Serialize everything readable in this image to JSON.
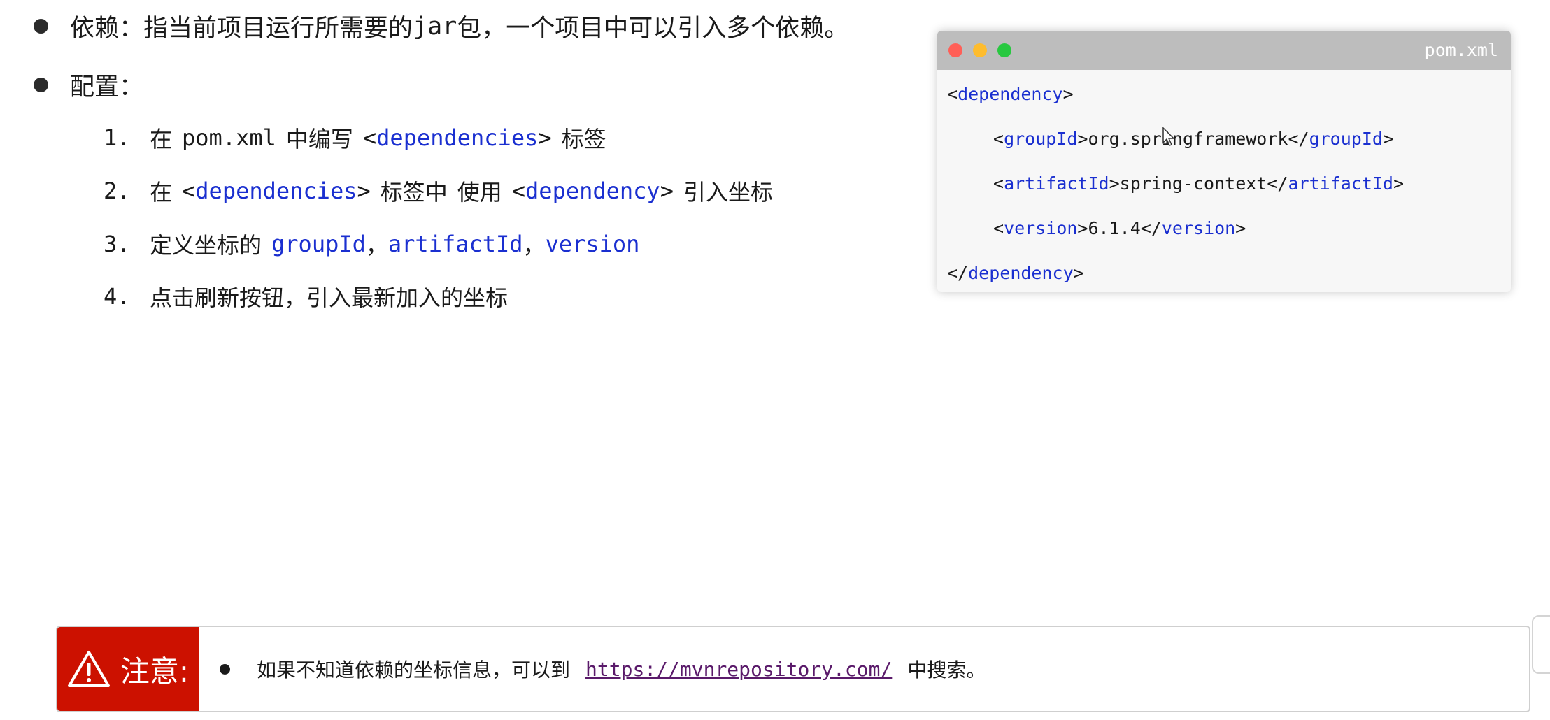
{
  "bullets": [
    {
      "label": "依赖",
      "sep": "：",
      "text_prefix": "指当前项目运行所需要的",
      "text_code": "jar",
      "text_suffix": "包，一个项目中可以引入多个依赖。"
    },
    {
      "label": "配置",
      "sep": "："
    }
  ],
  "steps": [
    {
      "num": "1.",
      "parts": [
        "在",
        "pom.xml",
        "中编写",
        "<",
        "dependencies",
        ">",
        "标签"
      ]
    },
    {
      "num": "2.",
      "parts": [
        "在",
        "<",
        "dependencies",
        ">",
        "标签中",
        "使用",
        "<",
        "dependency",
        ">",
        "引入坐标"
      ]
    },
    {
      "num": "3.",
      "parts": [
        "定义坐标的",
        "groupId",
        "，",
        "artifactId",
        "，",
        "version"
      ]
    },
    {
      "num": "4.",
      "parts": [
        "点击刷新按钮，引入最新加入的坐标"
      ]
    }
  ],
  "code_window": {
    "filename": "pom.xml",
    "lines": [
      {
        "indent": "",
        "open_lt": "<",
        "tag": "dependency",
        "open_gt": ">",
        "content": "",
        "close_lt": "",
        "close_tag": "",
        "close_gt": ""
      },
      {
        "indent": "    ",
        "open_lt": "<",
        "tag": "groupId",
        "open_gt": ">",
        "content": "org.springframework",
        "close_lt": "</",
        "close_tag": "groupId",
        "close_gt": ">"
      },
      {
        "indent": "    ",
        "open_lt": "<",
        "tag": "artifactId",
        "open_gt": ">",
        "content": "spring-context",
        "close_lt": "</",
        "close_tag": "artifactId",
        "close_gt": ">"
      },
      {
        "indent": "    ",
        "open_lt": "<",
        "tag": "version",
        "open_gt": ">",
        "content": "6.1.4",
        "close_lt": "</",
        "close_tag": "version",
        "close_gt": ">"
      },
      {
        "indent": "",
        "open_lt": "</",
        "tag": "dependency",
        "open_gt": ">",
        "content": "",
        "close_lt": "",
        "close_tag": "",
        "close_gt": ""
      }
    ]
  },
  "note": {
    "label": "注意:",
    "text_prefix": "如果不知道依赖的坐标信息，可以到",
    "link": "https://mvnrepository.com/",
    "text_suffix": "中搜索。"
  },
  "colors": {
    "keyword": "#1a2fd0",
    "note_red": "#cc1100",
    "link": "#5a1a6a",
    "titlebar": "#bdbdbd"
  }
}
